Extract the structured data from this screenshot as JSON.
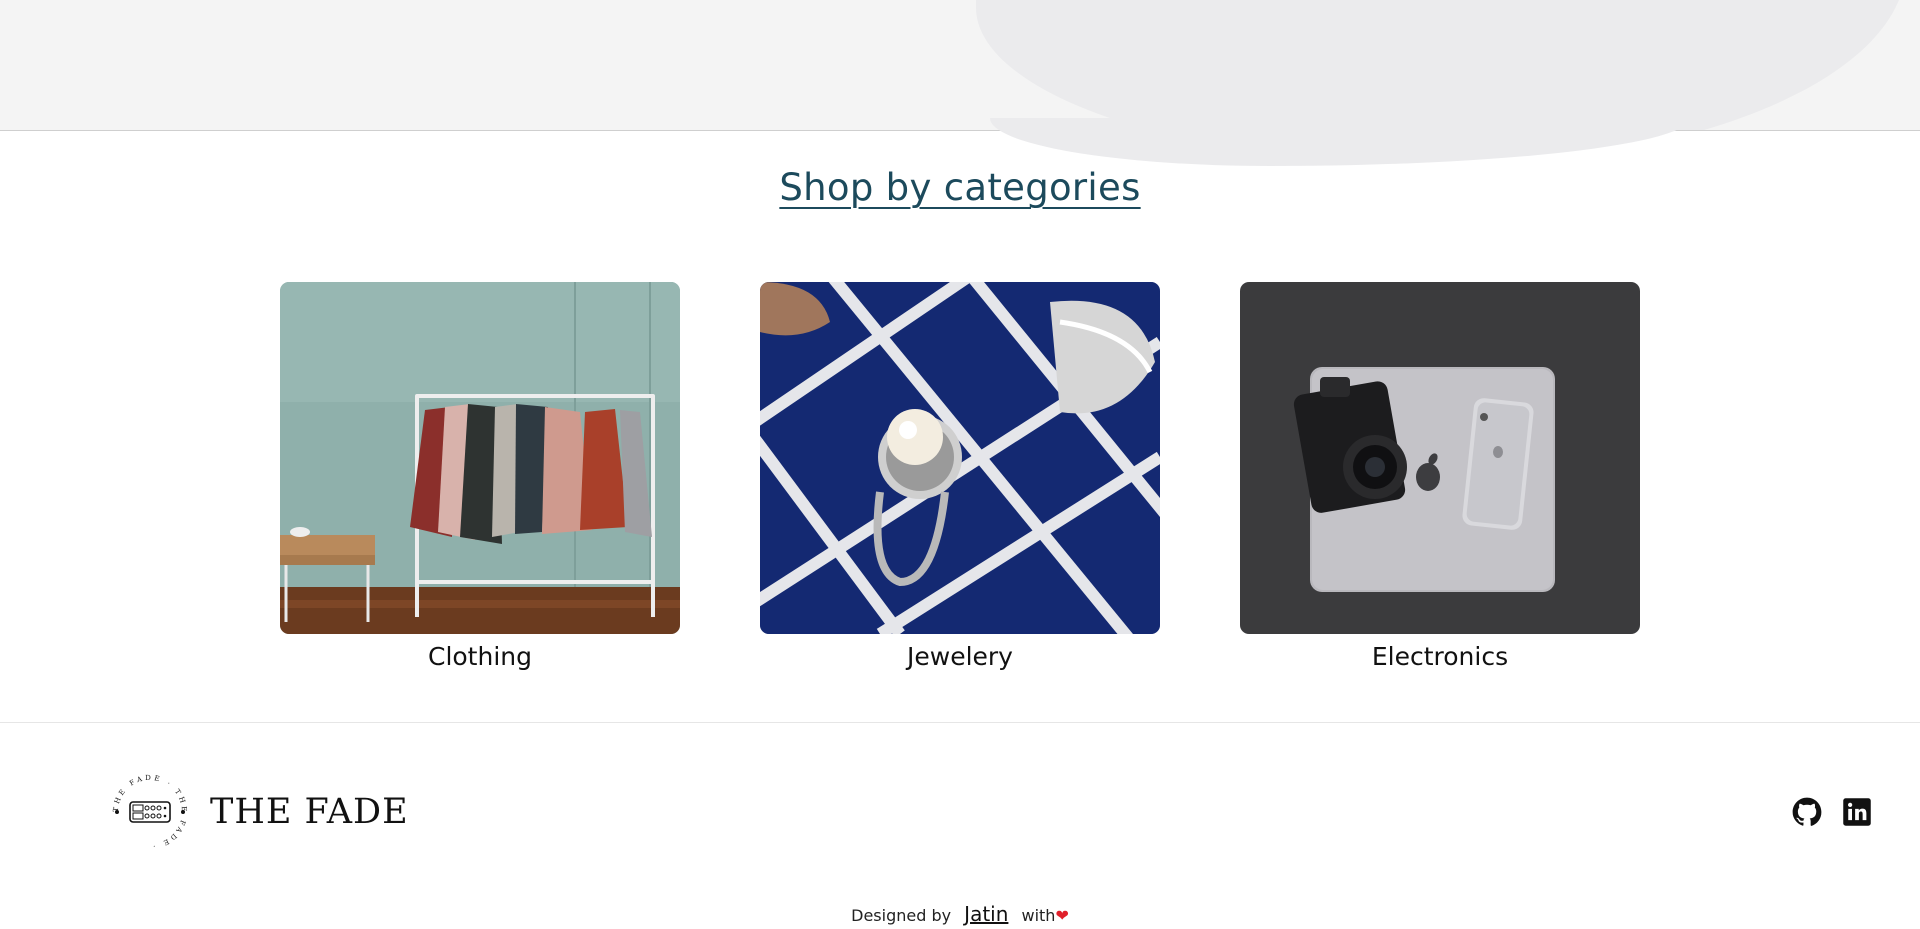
{
  "categories": {
    "title": "Shop by categories",
    "items": [
      {
        "label": "Clothing",
        "image": "clothing-rack-photo"
      },
      {
        "label": "Jewelery",
        "image": "pearl-ring-photo"
      },
      {
        "label": "Electronics",
        "image": "camera-laptop-phone-photo"
      }
    ]
  },
  "footer": {
    "brand_name": "THE FADE",
    "logo_ring_text": "THE FADE",
    "social": [
      {
        "icon": "github-icon"
      },
      {
        "icon": "linkedin-icon"
      }
    ],
    "credits": {
      "prefix": "Designed by",
      "author": "Jatin",
      "suffix": "with",
      "heart": "❤"
    }
  },
  "colors": {
    "title": "#1c4a5c",
    "hero_bg": "#f4f4f4",
    "heart": "#e0202a"
  }
}
